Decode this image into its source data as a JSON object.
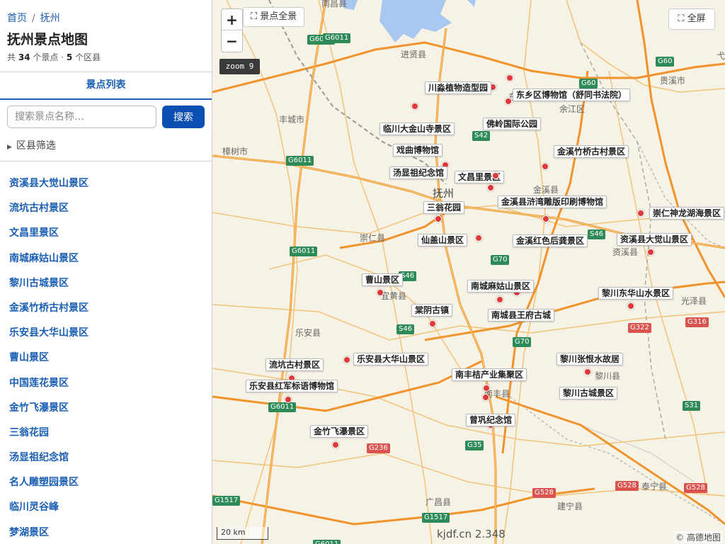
{
  "breadcrumb": {
    "home": "首页",
    "separator": "/",
    "current": "抚州"
  },
  "page_title": "抚州景点地图",
  "stats": {
    "prefix": "共",
    "spot_count": "34",
    "spot_unit": "个景点",
    "dot": "·",
    "district_count": "5",
    "district_unit": "个区县"
  },
  "tab": {
    "label": "景点列表"
  },
  "search": {
    "placeholder": "搜索景点名称…",
    "button": "搜索"
  },
  "filter": {
    "label": "区县筛选"
  },
  "spots": [
    "资溪县大觉山景区",
    "流坑古村景区",
    "文昌里景区",
    "南城麻姑山景区",
    "黎川古城景区",
    "金溪竹桥古村景区",
    "乐安县大华山景区",
    "曹山景区",
    "中国莲花景区",
    "金竹飞瀑景区",
    "三翁花园",
    "汤显祖纪念馆",
    "名人雕塑园景区",
    "临川灵谷峰",
    "梦湖景区"
  ],
  "map": {
    "zoom_in": "+",
    "zoom_out": "−",
    "overview_button": "⛶ 景点全景",
    "fullscreen_button": "⛶ 全屏",
    "zoom_badge": "zoom 9",
    "scale": "20 km",
    "watermark": "kjdf.cn 2.348",
    "attribution": "© 高德地图",
    "colors": {
      "road": "#f5a742",
      "expressway": "#f0932b",
      "water": "#a9c8f0",
      "land": "#f7f2e6",
      "marker": "#e0383a"
    },
    "poi_labels": [
      "川淼植物造型园",
      "东乡区博物馆（舒同书法院）",
      "临川大金山寺景区",
      "佛岭国际公园",
      "戏曲博物馆",
      "金溪竹桥古村景区",
      "汤显祖纪念馆",
      "文昌里景区",
      "三翁花园",
      "金溪县浒湾雕版印刷博物馆",
      "崇仁神龙湖海景区",
      "仙盖山景区",
      "金溪红色后龚景区",
      "资溪县大觉山景区",
      "曹山景区",
      "南城麻姑山景区",
      "黎川东华山水景区",
      "棠阴古镇",
      "南城县王府古城",
      "乐安县大华山景区",
      "流坑古村景区",
      "黎川张恨水故居",
      "南丰桔产业集聚区",
      "乐安县红军标语博物馆",
      "黎川古城景区",
      "曾巩纪念馆",
      "金竹飞瀑景区"
    ],
    "places": [
      "南昌县",
      "进贤县",
      "丰城市",
      "樟树市",
      "东乡区",
      "余江区",
      "贵溪市",
      "抚州",
      "金溪县",
      "崇仁县",
      "资溪县",
      "宜黄县",
      "乐安县",
      "光泽县",
      "黎川县",
      "南丰县",
      "广昌县",
      "泰宁县",
      "建宁县",
      "弋阳"
    ],
    "shields": [
      "G6011",
      "G60",
      "G6011",
      "S42",
      "G6011",
      "G6011",
      "S46",
      "G70",
      "S46",
      "G70",
      "S46",
      "G322",
      "G316",
      "G6011",
      "G236",
      "G35",
      "G528",
      "G528",
      "G528",
      "G1517",
      "G1517",
      "S31",
      "G60",
      "G6011"
    ]
  }
}
